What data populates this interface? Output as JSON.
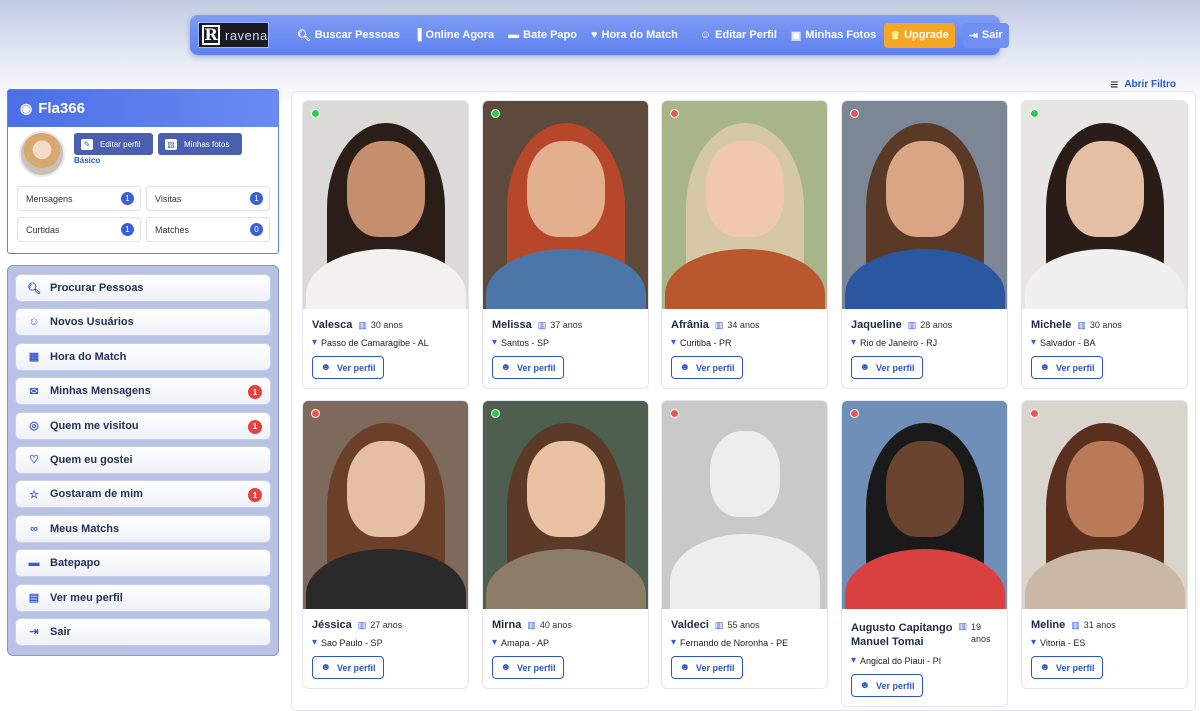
{
  "app": {
    "logo_letter": "R",
    "logo_text": "ravena"
  },
  "nav": {
    "items": [
      {
        "icon": "search-icon",
        "label": "Buscar Pessoas"
      },
      {
        "icon": "signal-icon",
        "label": "Online Agora"
      },
      {
        "icon": "chat-icon",
        "label": "Bate Papo"
      },
      {
        "icon": "heart-icon",
        "label": "Hora do Match"
      },
      {
        "icon": "user-edit-icon",
        "label": "Editar Perfil"
      },
      {
        "icon": "camera-icon",
        "label": "Minhas Fotos"
      }
    ],
    "upgrade_label": "Upgrade",
    "logout_label": "Sair"
  },
  "filter": {
    "label": "Abrir Filtro"
  },
  "profile": {
    "username": "Fla366",
    "edit_label": "Editar perfil",
    "photos_label": "Minhas fotos",
    "plan": "Básico",
    "stats": [
      {
        "label": "Mensagens",
        "count": "1"
      },
      {
        "label": "Visitas",
        "count": "1"
      },
      {
        "label": "Curtidas",
        "count": "1"
      },
      {
        "label": "Matches",
        "count": "0"
      }
    ]
  },
  "menu": {
    "items": [
      {
        "icon": "search-icon",
        "label": "Procurar Pessoas",
        "badge": ""
      },
      {
        "icon": "user-plus-icon",
        "label": "Novos Usuários",
        "badge": ""
      },
      {
        "icon": "calendar-icon",
        "label": "Hora do Match",
        "badge": ""
      },
      {
        "icon": "envelope-icon",
        "label": "Minhas Mensagens",
        "badge": "1"
      },
      {
        "icon": "eye-icon",
        "label": "Quem me visitou",
        "badge": "1"
      },
      {
        "icon": "heart-icon",
        "label": "Quem eu gostei",
        "badge": ""
      },
      {
        "icon": "star-icon",
        "label": "Gostaram de mim",
        "badge": "1"
      },
      {
        "icon": "link-icon",
        "label": "Meus Matchs",
        "badge": ""
      },
      {
        "icon": "comment-icon",
        "label": "Batepapo",
        "badge": ""
      },
      {
        "icon": "id-card-icon",
        "label": "Ver meu perfil",
        "badge": ""
      },
      {
        "icon": "logout-icon",
        "label": "Sair",
        "badge": ""
      }
    ]
  },
  "cards": {
    "view_label": "Ver perfil",
    "items": [
      {
        "name": "Valesca",
        "age": "30 anos",
        "location": "Passo de Camaragibe - AL",
        "online": true
      },
      {
        "name": "Melissa",
        "age": "37 anos",
        "location": "Santos - SP",
        "online": true
      },
      {
        "name": "Afrânia",
        "age": "34 anos",
        "location": "Curitiba - PR",
        "online": false
      },
      {
        "name": "Jaqueline",
        "age": "28 anos",
        "location": "Rio de Janeiro - RJ",
        "online": false
      },
      {
        "name": "Michele",
        "age": "30 anos",
        "location": "Salvador - BA",
        "online": true
      },
      {
        "name": "Jéssica",
        "age": "27 anos",
        "location": "Sao Paulo - SP",
        "online": false
      },
      {
        "name": "Mirna",
        "age": "40 anos",
        "location": "Amapa - AP",
        "online": true
      },
      {
        "name": "Valdeci",
        "age": "55 anos",
        "location": "Fernando de Noronha - PE",
        "online": false
      },
      {
        "name": "Augusto Capitango Manuel Tomai",
        "age": "19 anos",
        "location": "Angical do Piaui - PI",
        "online": false
      },
      {
        "name": "Meline",
        "age": "31 anos",
        "location": "Vitoria - ES",
        "online": false
      }
    ]
  },
  "colors": {
    "accent": "#5f81ee",
    "upgrade": "#f5a623",
    "online": "#2ec94a",
    "offline": "#e85757",
    "badge": "#e64040"
  }
}
